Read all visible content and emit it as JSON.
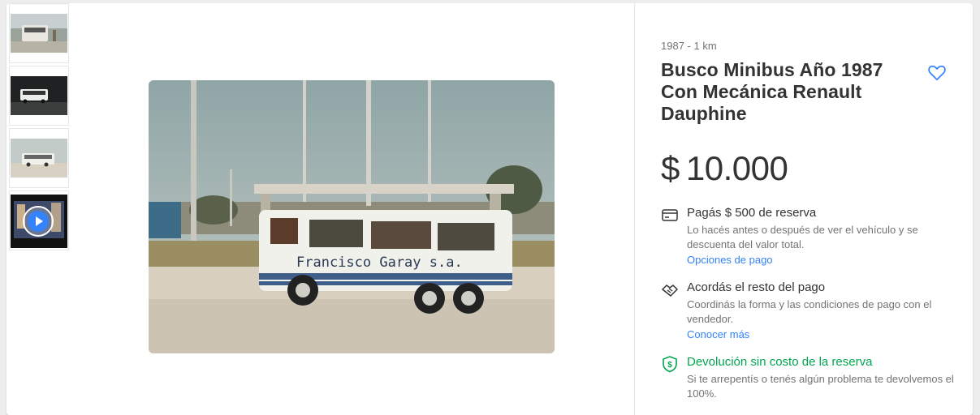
{
  "thumbnails": [
    {
      "label": "photo-1"
    },
    {
      "label": "photo-2"
    },
    {
      "label": "photo-3",
      "active": true
    },
    {
      "label": "video-thumbnail",
      "video": true
    }
  ],
  "product": {
    "subtitle": "1987  -  1 km",
    "title": "Busco Minibus Año 1987 Con Mecánica Renault Dauphine",
    "currency": "$",
    "price": "10.000"
  },
  "photo": {
    "bus_text": "Francisco Garay s.a."
  },
  "reservation": {
    "title": "Pagás $ 500 de reserva",
    "desc": "Lo hacés antes o después de ver el vehículo y se descuenta del valor total.",
    "link": "Opciones de pago"
  },
  "payment": {
    "title": "Acordás el resto del pago",
    "desc": "Coordinás la forma y las condiciones de pago con el vendedor.",
    "link": "Conocer más"
  },
  "refund": {
    "title": "Devolución sin costo de la reserva",
    "desc": "Si te arrepentís o tenés algún problema te devolvemos el 100%."
  },
  "colors": {
    "accent": "#3483fa",
    "green": "#00a650"
  },
  "icons": [
    "heart-icon",
    "card-icon",
    "handshake-icon",
    "shield-dollar-icon",
    "play-icon"
  ]
}
